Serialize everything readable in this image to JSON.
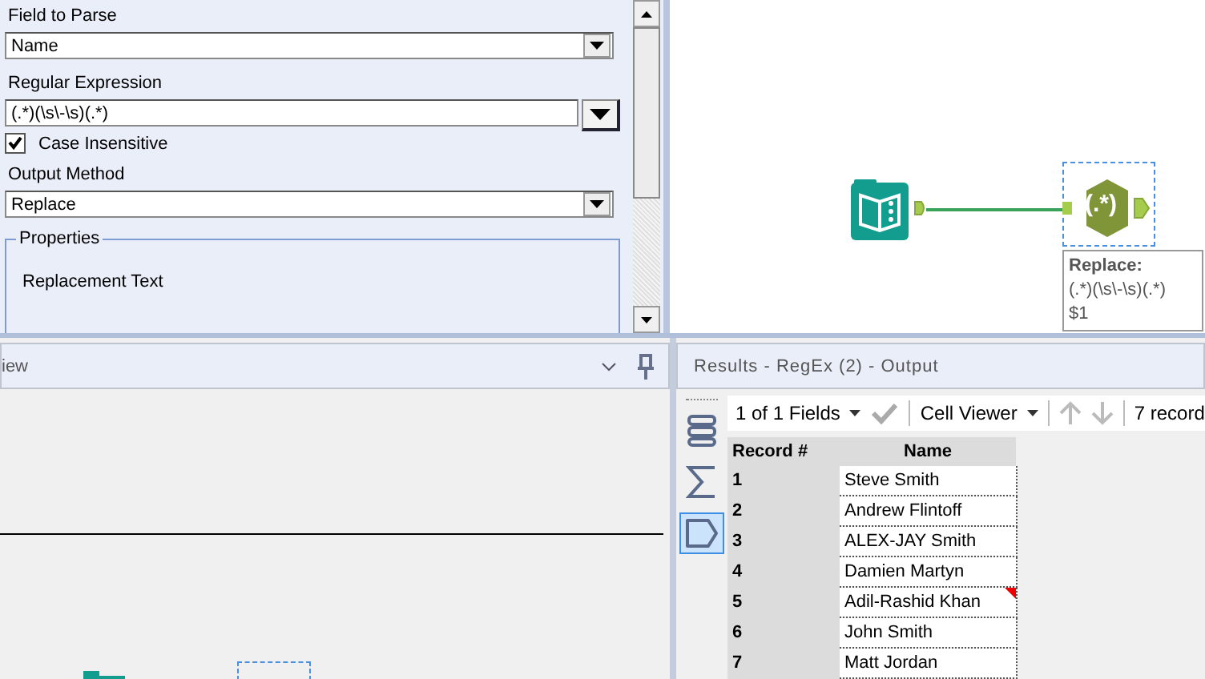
{
  "config": {
    "field_to_parse": {
      "label": "Field to Parse",
      "value": "Name"
    },
    "regular_expression": {
      "label": "Regular Expression",
      "value": "(.*)(\\s\\-\\s)(.*)"
    },
    "case_insensitive": {
      "label": "Case Insensitive",
      "checked": true
    },
    "output_method": {
      "label": "Output Method",
      "value": "Replace"
    },
    "properties": {
      "title": "Properties",
      "replacement_label": "Replacement Text"
    }
  },
  "canvas": {
    "tooltip": [
      "Replace:",
      "(.*)(\\s\\-\\s)(.*)",
      "$1"
    ],
    "regex_node_label": "(.*)"
  },
  "lower_left": {
    "title": "iew"
  },
  "results": {
    "title": "Results - RegEx (2) - Output",
    "toolbar": {
      "fields": "1 of 1 Fields",
      "viewer": "Cell Viewer",
      "records": "7 record"
    },
    "side_icons": [
      {
        "kind": "rows",
        "selected": false
      },
      {
        "kind": "sum",
        "selected": false
      },
      {
        "kind": "tag",
        "selected": true
      }
    ],
    "columns": [
      "Record #",
      "Name"
    ],
    "rows": [
      {
        "record": "1",
        "name": "Steve Smith",
        "flagged": false
      },
      {
        "record": "2",
        "name": "Andrew Flintoff",
        "flagged": false
      },
      {
        "record": "3",
        "name": "ALEX-JAY Smith",
        "flagged": false
      },
      {
        "record": "4",
        "name": "Damien Martyn",
        "flagged": false
      },
      {
        "record": "5",
        "name": "Adil-Rashid Khan",
        "flagged": true
      },
      {
        "record": "6",
        "name": "John Smith",
        "flagged": false
      },
      {
        "record": "7",
        "name": "Matt Jordan",
        "flagged": false
      }
    ]
  }
}
